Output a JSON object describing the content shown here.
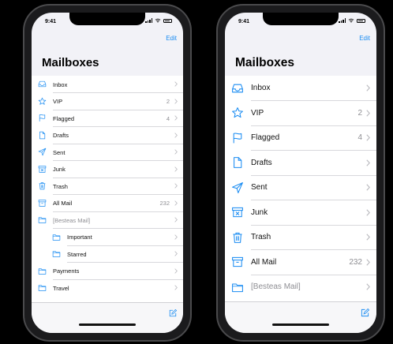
{
  "colors": {
    "accent": "#1a8cf2",
    "background": "#f2f2f7",
    "count": "#8e8e93"
  },
  "phones": [
    {
      "status_time": "9:41",
      "edit_label": "Edit",
      "title": "Mailboxes",
      "rows": [
        {
          "icon": "tray-icon",
          "label": "Inbox",
          "count": "",
          "indent": 0,
          "muted": false
        },
        {
          "icon": "star-icon",
          "label": "VIP",
          "count": "2",
          "indent": 0,
          "muted": false
        },
        {
          "icon": "flag-icon",
          "label": "Flagged",
          "count": "4",
          "indent": 0,
          "muted": false
        },
        {
          "icon": "doc-icon",
          "label": "Drafts",
          "count": "",
          "indent": 0,
          "muted": false
        },
        {
          "icon": "paperplane-icon",
          "label": "Sent",
          "count": "",
          "indent": 0,
          "muted": false
        },
        {
          "icon": "junk-icon",
          "label": "Junk",
          "count": "",
          "indent": 0,
          "muted": false
        },
        {
          "icon": "trash-icon",
          "label": "Trash",
          "count": "",
          "indent": 0,
          "muted": false
        },
        {
          "icon": "archive-icon",
          "label": "All Mail",
          "count": "232",
          "indent": 0,
          "muted": false
        },
        {
          "icon": "folder-icon",
          "label": "[Besteas Mail]",
          "count": "",
          "indent": 0,
          "muted": true
        },
        {
          "icon": "folder-icon",
          "label": "Important",
          "count": "",
          "indent": 1,
          "muted": false
        },
        {
          "icon": "folder-icon",
          "label": "Starred",
          "count": "",
          "indent": 1,
          "muted": false
        },
        {
          "icon": "folder-icon",
          "label": "Payments",
          "count": "",
          "indent": 0,
          "muted": false
        },
        {
          "icon": "folder-icon",
          "label": "Travel",
          "count": "",
          "indent": 0,
          "muted": false
        }
      ]
    },
    {
      "status_time": "9:41",
      "edit_label": "Edit",
      "title": "Mailboxes",
      "rows": [
        {
          "icon": "tray-icon",
          "label": "Inbox",
          "count": "",
          "indent": 0,
          "muted": false
        },
        {
          "icon": "star-icon",
          "label": "VIP",
          "count": "2",
          "indent": 0,
          "muted": false
        },
        {
          "icon": "flag-icon",
          "label": "Flagged",
          "count": "4",
          "indent": 0,
          "muted": false
        },
        {
          "icon": "doc-icon",
          "label": "Drafts",
          "count": "",
          "indent": 0,
          "muted": false
        },
        {
          "icon": "paperplane-icon",
          "label": "Sent",
          "count": "",
          "indent": 0,
          "muted": false
        },
        {
          "icon": "junk-icon",
          "label": "Junk",
          "count": "",
          "indent": 0,
          "muted": false
        },
        {
          "icon": "trash-icon",
          "label": "Trash",
          "count": "",
          "indent": 0,
          "muted": false
        },
        {
          "icon": "archive-icon",
          "label": "All Mail",
          "count": "232",
          "indent": 0,
          "muted": false
        },
        {
          "icon": "folder-icon",
          "label": "[Besteas Mail]",
          "count": "",
          "indent": 0,
          "muted": true
        }
      ]
    }
  ]
}
